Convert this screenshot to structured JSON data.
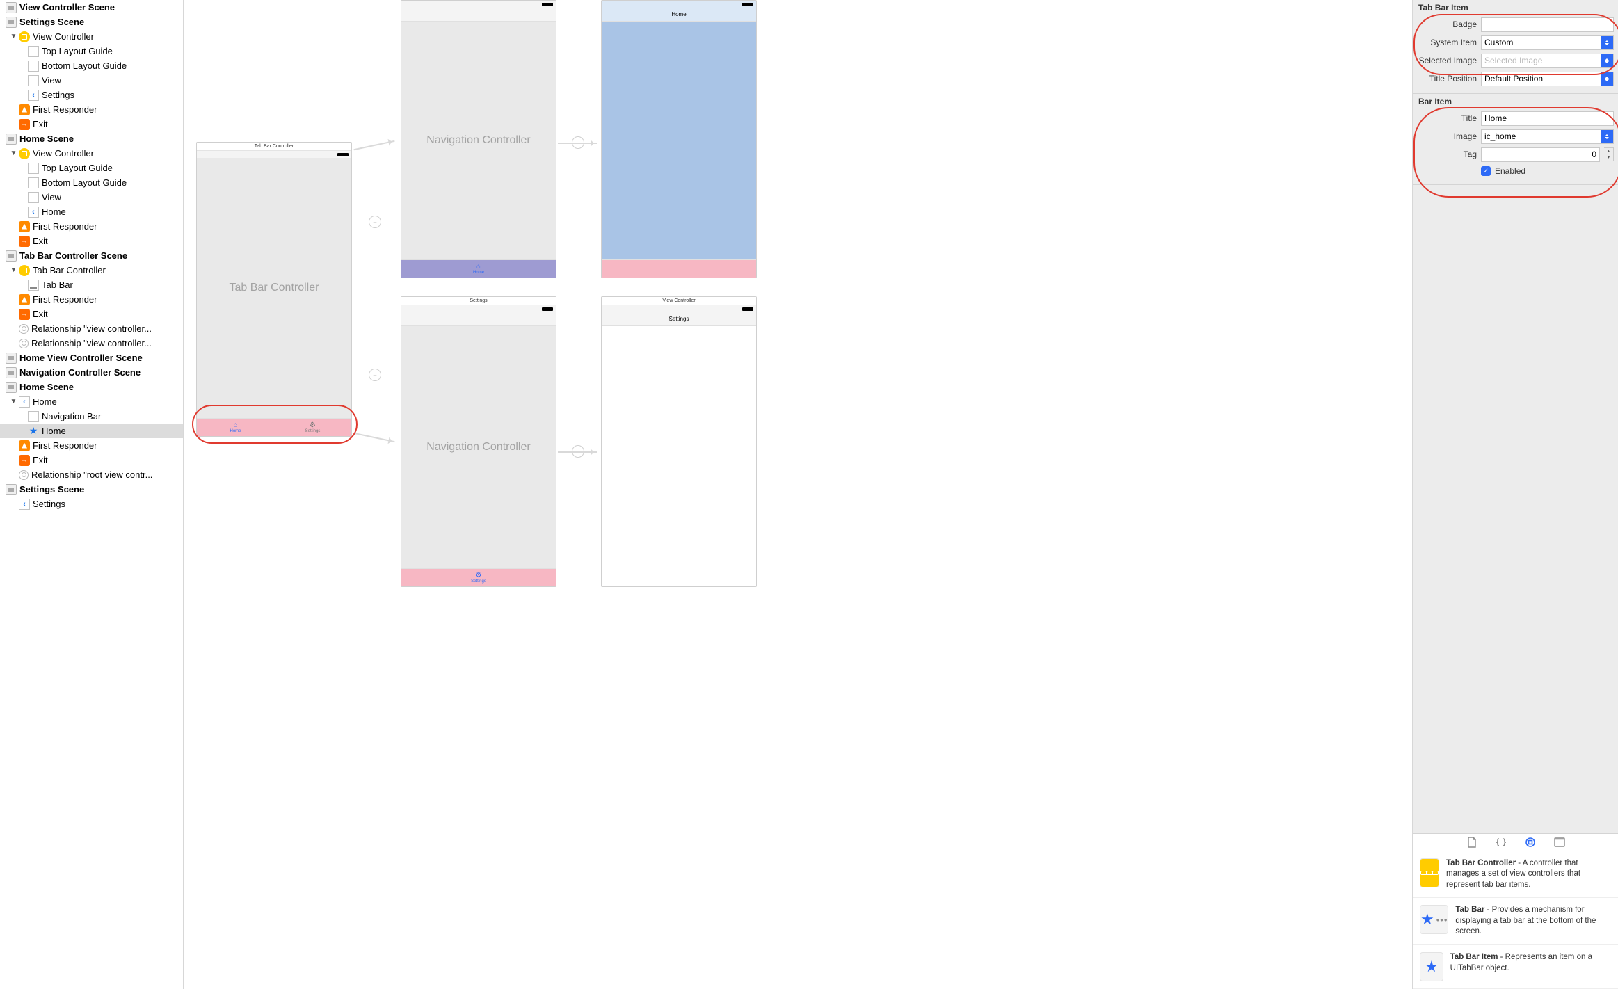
{
  "outline": {
    "scenes": [
      {
        "title": "View Controller Scene",
        "items": []
      },
      {
        "title": "Settings Scene",
        "items": [
          {
            "type": "vc",
            "label": "View Controller",
            "children": [
              {
                "type": "layout",
                "label": "Top Layout Guide"
              },
              {
                "type": "layout",
                "label": "Bottom Layout Guide"
              },
              {
                "type": "layout",
                "label": "View"
              },
              {
                "type": "back",
                "label": "Settings"
              }
            ]
          },
          {
            "type": "first",
            "label": "First Responder"
          },
          {
            "type": "exit",
            "label": "Exit"
          }
        ]
      },
      {
        "title": "Home Scene",
        "items": [
          {
            "type": "vc",
            "label": "View Controller",
            "children": [
              {
                "type": "layout",
                "label": "Top Layout Guide"
              },
              {
                "type": "layout",
                "label": "Bottom Layout Guide"
              },
              {
                "type": "layout",
                "label": "View"
              },
              {
                "type": "back",
                "label": "Home"
              }
            ]
          },
          {
            "type": "first",
            "label": "First Responder"
          },
          {
            "type": "exit",
            "label": "Exit"
          }
        ]
      },
      {
        "title": "Tab Bar Controller Scene",
        "items": [
          {
            "type": "vc",
            "label": "Tab Bar Controller",
            "children": [
              {
                "type": "tabbar",
                "label": "Tab Bar"
              }
            ]
          },
          {
            "type": "first",
            "label": "First Responder"
          },
          {
            "type": "exit",
            "label": "Exit"
          },
          {
            "type": "relation",
            "label": "Relationship \"view controller..."
          },
          {
            "type": "relation",
            "label": "Relationship \"view controller..."
          }
        ]
      },
      {
        "title": "Home View Controller Scene",
        "items": []
      },
      {
        "title": "Navigation Controller Scene",
        "items": []
      },
      {
        "title": "Home Scene",
        "items": [
          {
            "type": "back",
            "label": "Home",
            "children": [
              {
                "type": "layout",
                "label": "Navigation Bar"
              },
              {
                "type": "star",
                "label": "Home",
                "selected": true
              }
            ]
          },
          {
            "type": "first",
            "label": "First Responder"
          },
          {
            "type": "exit",
            "label": "Exit"
          },
          {
            "type": "relation",
            "label": "Relationship \"root view contr..."
          }
        ]
      },
      {
        "title": "Settings Scene",
        "items": [
          {
            "type": "back",
            "label": "Settings"
          }
        ]
      }
    ]
  },
  "canvas": {
    "tabbar_title": "Tab Bar Controller",
    "tabbar_center": "Tab Bar Controller",
    "tabbar_tabs": [
      {
        "label": "Home",
        "active": true,
        "icon": "home-icon"
      },
      {
        "label": "Settings",
        "active": false,
        "icon": "gear-icon"
      }
    ],
    "nav1_center": "Navigation Controller",
    "nav1_tab": {
      "label": "Home",
      "icon": "home-icon"
    },
    "nav2_title": "Settings",
    "nav2_center": "Navigation Controller",
    "nav2_tab": {
      "label": "Settings",
      "icon": "gear-icon"
    },
    "home_title": "Home",
    "vc_title": "View Controller",
    "vc_nav": "Settings"
  },
  "inspector": {
    "section1_title": "Tab Bar Item",
    "badge_label": "Badge",
    "badge_value": "",
    "system_item_label": "System Item",
    "system_item_value": "Custom",
    "selected_image_label": "Selected Image",
    "selected_image_placeholder": "Selected Image",
    "title_position_label": "Title Position",
    "title_position_value": "Default Position",
    "section2_title": "Bar Item",
    "title_label": "Title",
    "title_value": "Home",
    "image_label": "Image",
    "image_value": "ic_home",
    "tag_label": "Tag",
    "tag_value": "0",
    "enabled_label": "Enabled"
  },
  "library": {
    "items": [
      {
        "name": "Tab Bar Controller",
        "desc": " - A controller that manages a set of view controllers that represent tab bar items.",
        "icon": "yellow"
      },
      {
        "name": "Tab Bar",
        "desc": " - Provides a mechanism for displaying a tab bar at the bottom of the screen.",
        "icon": "starbar"
      },
      {
        "name": "Tab Bar Item",
        "desc": " - Represents an item on a UITabBar object.",
        "icon": "star"
      }
    ]
  }
}
